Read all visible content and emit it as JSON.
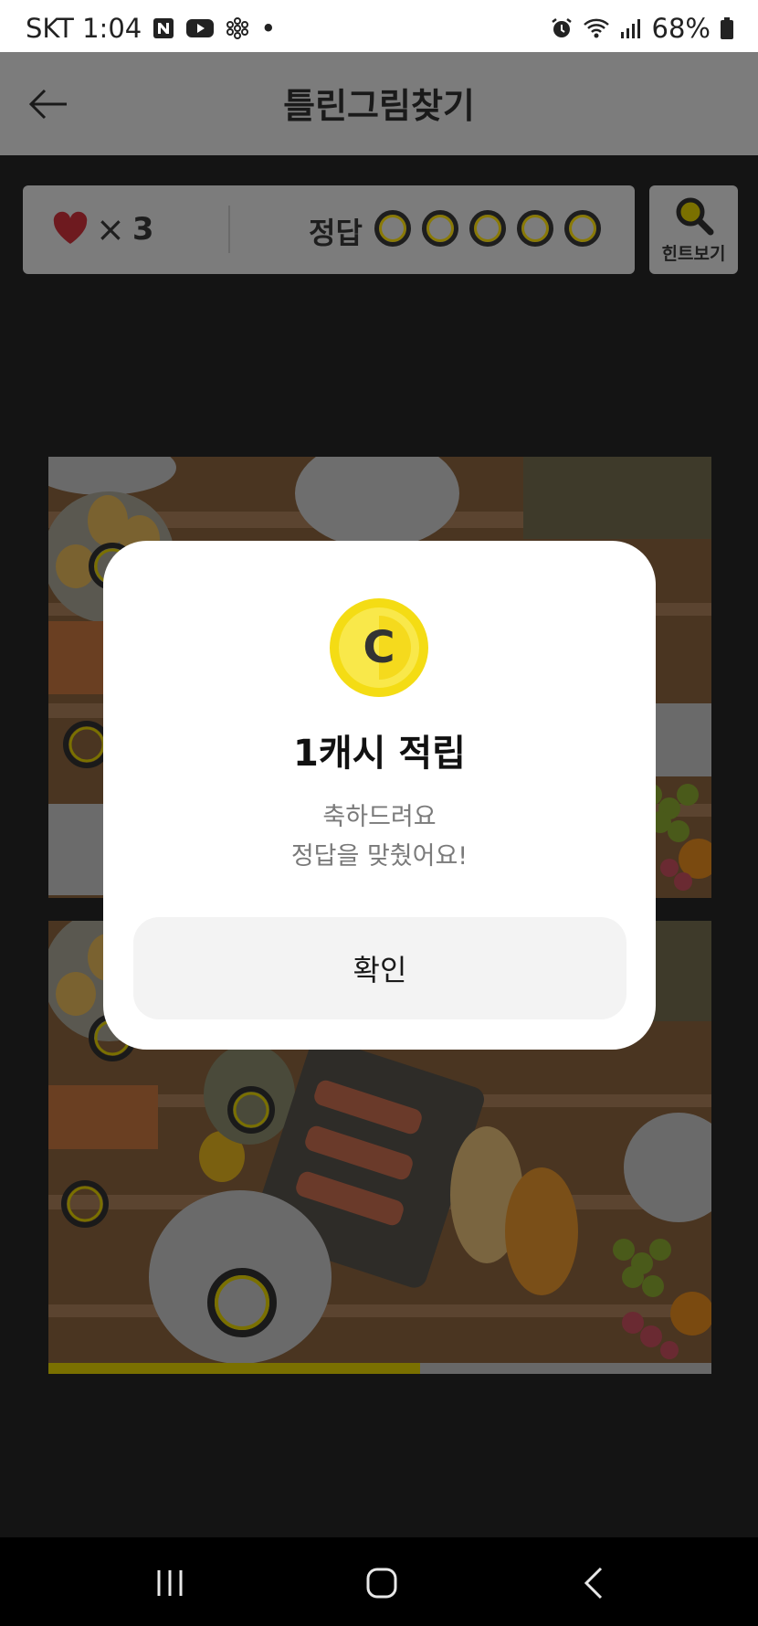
{
  "status_bar": {
    "carrier_time": "SKT 1:04",
    "dot": "•",
    "battery": "68%",
    "icons": [
      "naver-icon",
      "youtube-icon",
      "flower-icon",
      "alarm-icon",
      "wifi-icon",
      "signal-icon",
      "battery-icon"
    ]
  },
  "header": {
    "title": "틀린그림찾기",
    "back_icon": "arrow-left-icon"
  },
  "game_status": {
    "lives_sign": "×",
    "lives": "3",
    "answer_label": "정답",
    "answers_total": 5,
    "answers_found": 0,
    "hint_label": "힌트보기"
  },
  "progress": {
    "fraction": 0.56
  },
  "dialog": {
    "coin_letter": "C",
    "title": "1캐시 적립",
    "message_line1": "축하드려요",
    "message_line2": "정답을 맞췄어요!",
    "confirm_label": "확인"
  },
  "colors": {
    "accent_yellow": "#f5d800",
    "heart_red": "#d7262f",
    "overlay_dark": "#141414"
  },
  "navbar": {
    "icons": [
      "recents-icon",
      "home-icon",
      "back-icon"
    ]
  }
}
